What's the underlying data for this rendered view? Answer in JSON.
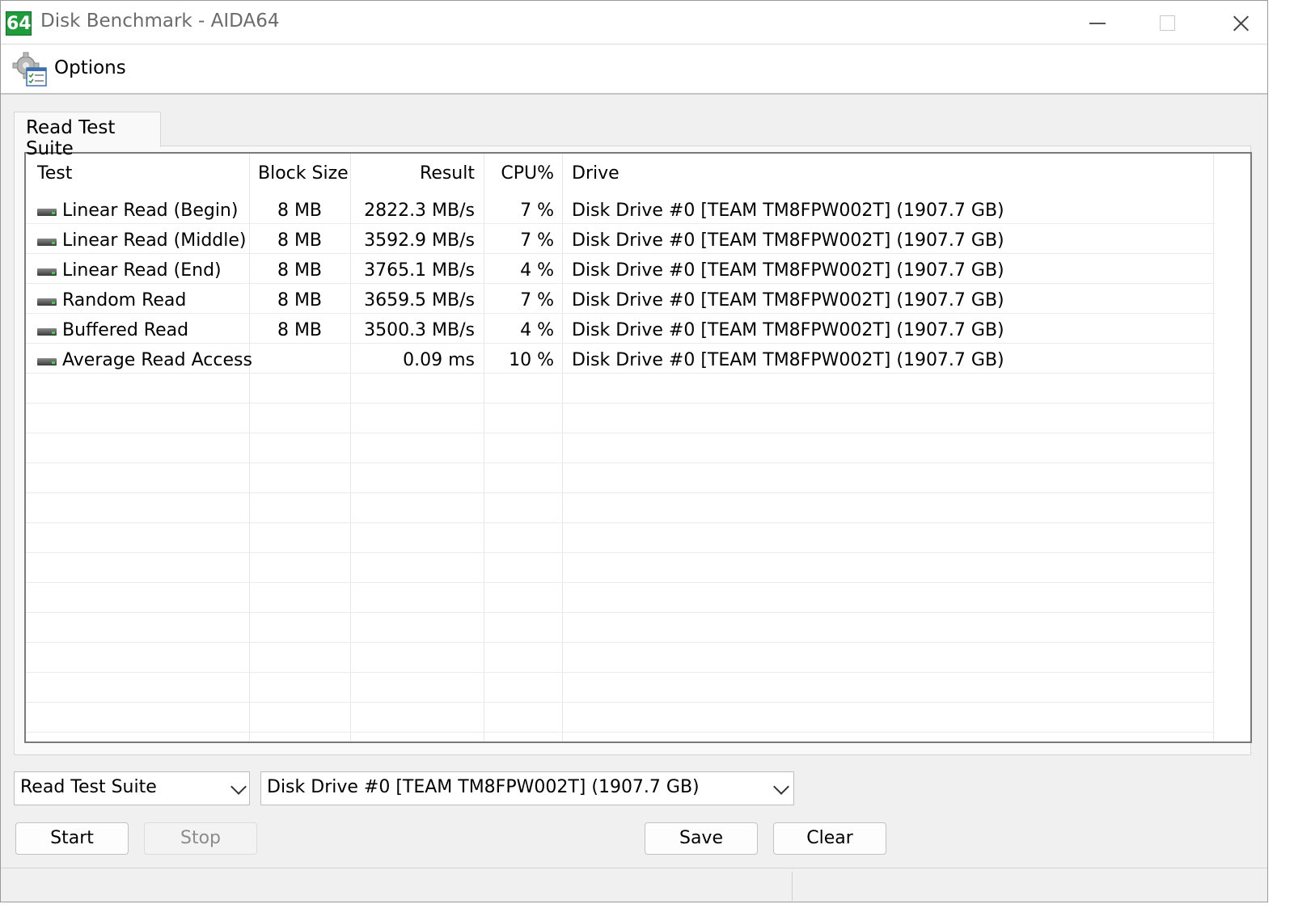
{
  "window": {
    "title": "Disk Benchmark - AIDA64",
    "app_icon_text": "64"
  },
  "toolbar": {
    "options_label": "Options"
  },
  "tabs": [
    {
      "label": "Read Test Suite",
      "active": true
    }
  ],
  "table": {
    "columns": [
      "Test",
      "Block Size",
      "Result",
      "CPU%",
      "Drive"
    ],
    "rows": [
      {
        "test": "Linear Read (Begin)",
        "block_size": "8 MB",
        "result": "2822.3 MB/s",
        "cpu": "7 %",
        "drive": "Disk Drive #0  [TEAM TM8FPW002T]  (1907.7 GB)"
      },
      {
        "test": "Linear Read (Middle)",
        "block_size": "8 MB",
        "result": "3592.9 MB/s",
        "cpu": "7 %",
        "drive": "Disk Drive #0  [TEAM TM8FPW002T]  (1907.7 GB)"
      },
      {
        "test": "Linear Read (End)",
        "block_size": "8 MB",
        "result": "3765.1 MB/s",
        "cpu": "4 %",
        "drive": "Disk Drive #0  [TEAM TM8FPW002T]  (1907.7 GB)"
      },
      {
        "test": "Random Read",
        "block_size": "8 MB",
        "result": "3659.5 MB/s",
        "cpu": "7 %",
        "drive": "Disk Drive #0  [TEAM TM8FPW002T]  (1907.7 GB)"
      },
      {
        "test": "Buffered Read",
        "block_size": "8 MB",
        "result": "3500.3 MB/s",
        "cpu": "4 %",
        "drive": "Disk Drive #0  [TEAM TM8FPW002T]  (1907.7 GB)"
      },
      {
        "test": "Average Read Access",
        "block_size": "",
        "result": "0.09 ms",
        "cpu": "10 %",
        "drive": "Disk Drive #0  [TEAM TM8FPW002T]  (1907.7 GB)"
      }
    ]
  },
  "controls": {
    "suite_select": {
      "value": "Read Test Suite"
    },
    "drive_select": {
      "value": "Disk Drive #0  [TEAM TM8FPW002T]  (1907.7 GB)"
    },
    "start_label": "Start",
    "stop_label": "Stop",
    "save_label": "Save",
    "clear_label": "Clear"
  },
  "colors": {
    "app_icon": "#1f9d3a",
    "disk_led": "#3fd04a"
  },
  "icons": {
    "options": "gear-checklist-icon",
    "row": "hard-drive-icon"
  }
}
